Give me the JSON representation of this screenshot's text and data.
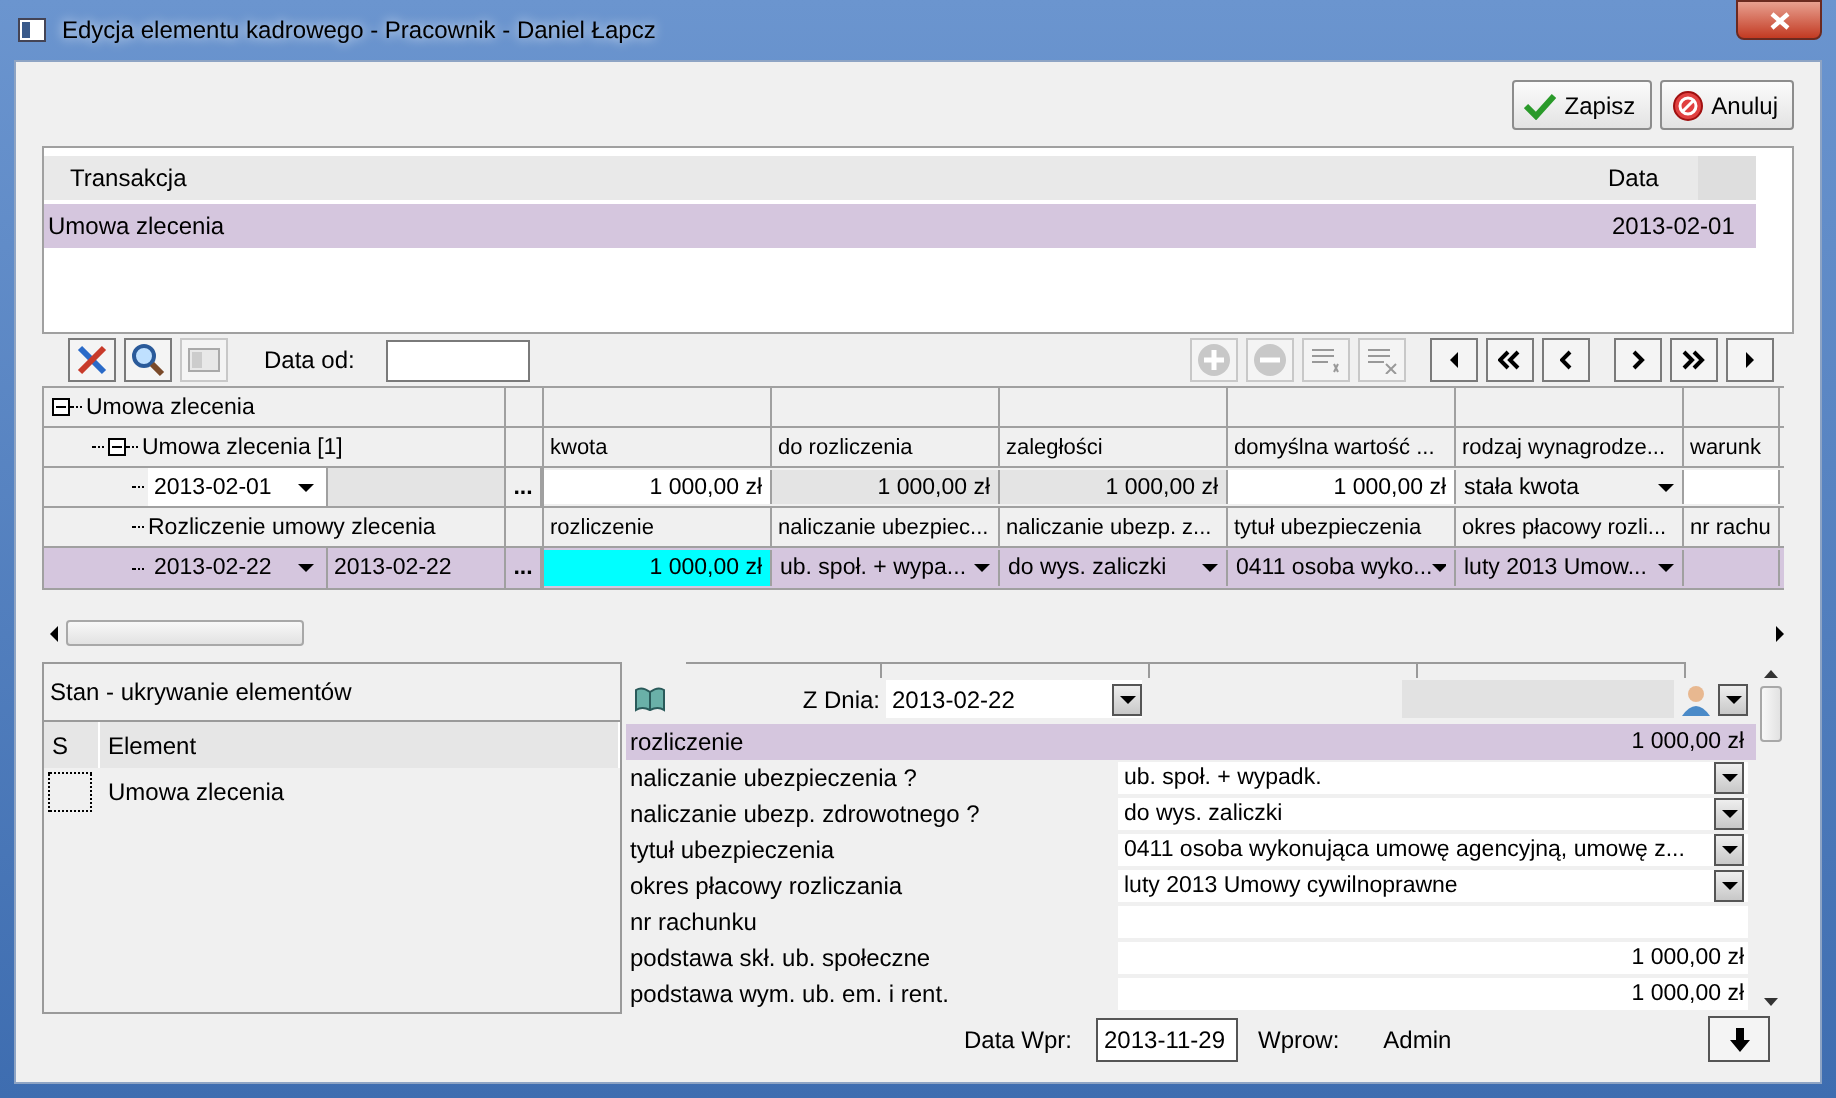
{
  "window": {
    "title": "Edycja elementu kadrowego - Pracownik - Daniel Łapcz"
  },
  "buttons": [
    {
      "label": "Zapisz",
      "kind": "save"
    },
    {
      "label": "Anuluj",
      "kind": "cancel"
    }
  ],
  "transactions": {
    "columns": [
      "Transakcja",
      "Data"
    ],
    "rows": [
      {
        "cells": [
          "Umowa zlecenia",
          "2013-02-01"
        ],
        "selected": true
      }
    ]
  },
  "toolbar": {
    "date_label": "Data od:"
  },
  "grid": {
    "tree": [
      {
        "kind": "group",
        "label": "Umowa zlecenia",
        "expanded": true,
        "children": [
          {
            "kind": "group",
            "label": "Umowa zlecenia [1]",
            "expanded": true,
            "columns": [
              "kwota",
              "do rozliczenia",
              "zaległości",
              "domyślna wartość ...",
              "rodzaj wynagrodze...",
              "warunk"
            ],
            "children": [
              {
                "kind": "record",
                "date": "2013-02-01",
                "more": "...",
                "selected": false,
                "cells": [
                  {
                    "kind": "input",
                    "text": "1 000,00 zł"
                  },
                  {
                    "kind": "readonly",
                    "text": "1 000,00 zł"
                  },
                  {
                    "kind": "readonly",
                    "text": "1 000,00 zł"
                  },
                  {
                    "kind": "input",
                    "text": "1 000,00 zł"
                  },
                  {
                    "kind": "select",
                    "text": "stała kwota"
                  },
                  {
                    "kind": "blank"
                  }
                ]
              },
              {
                "kind": "section",
                "label": "Rozliczenie umowy zlecenia",
                "columns": [
                  "rozliczenie",
                  "naliczanie ubezpiec...",
                  "naliczanie ubezp. z...",
                  "tytuł ubezpieczenia",
                  "okres płacowy rozli...",
                  "nr rachu"
                ]
              },
              {
                "kind": "record",
                "date": "2013-02-22",
                "date_to": "2013-02-22",
                "more": "...",
                "selected": true,
                "cells": [
                  {
                    "kind": "highlight",
                    "text": "1 000,00 zł"
                  },
                  {
                    "kind": "select",
                    "text": "ub. społ. + wypa..."
                  },
                  {
                    "kind": "select",
                    "text": "do wys. zaliczki"
                  },
                  {
                    "kind": "select",
                    "text": "0411 osoba wyko..."
                  },
                  {
                    "kind": "select",
                    "text": "luty 2013 Umow..."
                  },
                  {
                    "kind": "blank"
                  }
                ]
              }
            ]
          }
        ]
      }
    ]
  },
  "state_panel": {
    "title": "Stan - ukrywanie elementów",
    "columns": [
      "S",
      "Element"
    ],
    "rows": [
      {
        "label": "Umowa zlecenia",
        "checked": false
      }
    ]
  },
  "details": {
    "date_label": "Z Dnia:",
    "date_value": "2013-02-22",
    "properties": [
      {
        "label": "rozliczenie",
        "kind": "amount",
        "value": "1 000,00 zł",
        "selected": true
      },
      {
        "label": "naliczanie ubezpieczenia ?",
        "kind": "select",
        "value": "ub. społ. + wypadk.",
        "selected": false
      },
      {
        "label": "naliczanie ubezp. zdrowotnego ?",
        "kind": "select",
        "value": "do wys. zaliczki",
        "selected": false
      },
      {
        "label": "tytuł ubezpieczenia",
        "kind": "select",
        "value": "0411 osoba wykonująca umowę agencyjną, umowę z...",
        "selected": false
      },
      {
        "label": "okres płacowy rozliczania",
        "kind": "select",
        "value": "luty 2013 Umowy cywilnoprawne",
        "selected": false
      },
      {
        "label": "nr rachunku",
        "kind": "text",
        "selected": false
      },
      {
        "label": "podstawa skł. ub. społeczne",
        "kind": "amount",
        "value": "1 000,00 zł",
        "selected": false
      },
      {
        "label": "podstawa wym. ub. em. i rent.",
        "kind": "amount",
        "value": "1 000,00 zł",
        "selected": false
      }
    ]
  },
  "footer": {
    "date_label": "Data Wpr:",
    "date_value": "2013-11-29",
    "user_label": "Wprow:",
    "user": "Admin"
  }
}
